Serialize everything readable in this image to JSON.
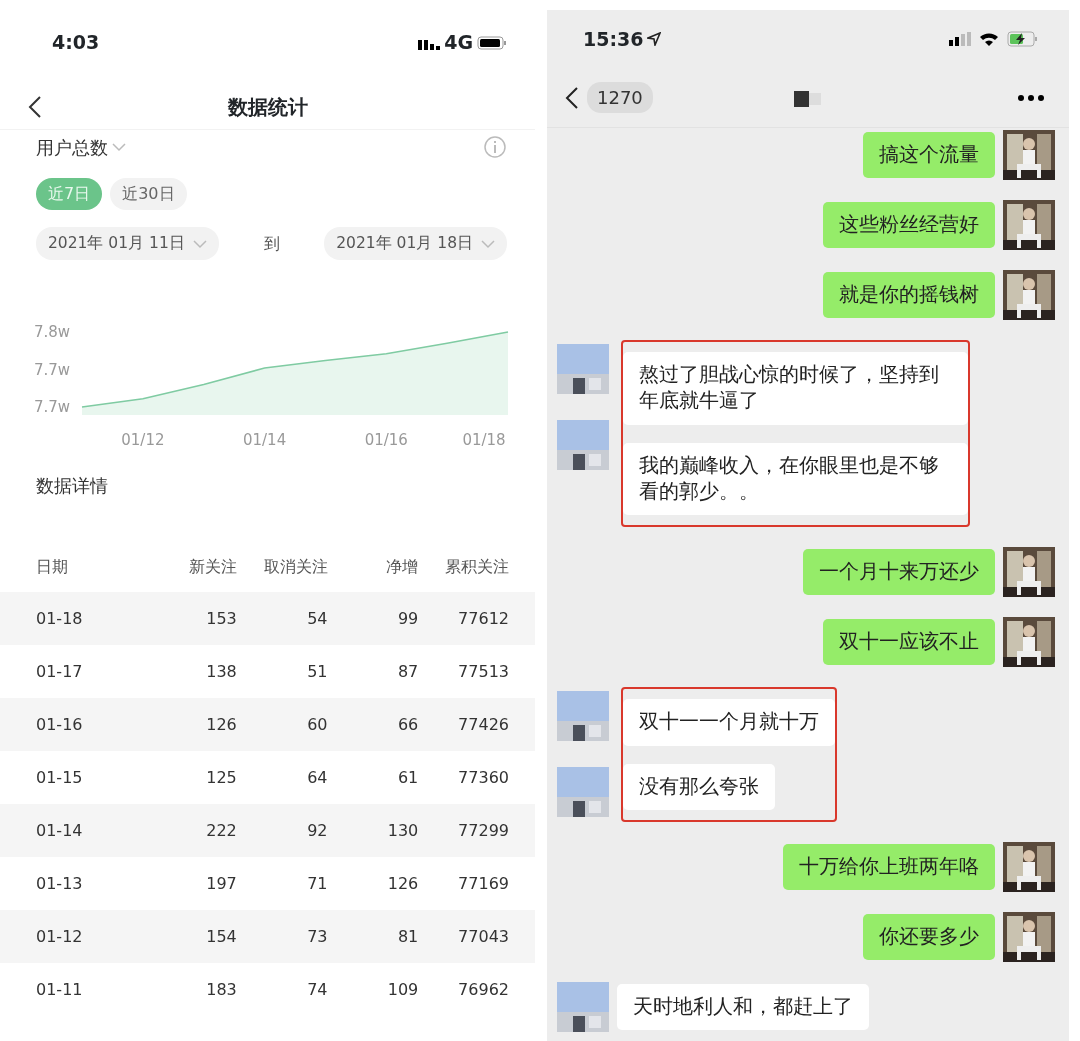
{
  "stats_screen": {
    "status_bar": {
      "time": "4:03",
      "network": "4G"
    },
    "title": "数据统计",
    "metric": "用户总数",
    "ranges": [
      {
        "label": "近7日",
        "selected": true
      },
      {
        "label": "近30日",
        "selected": false
      }
    ],
    "date_from": "2021年 01月 11日",
    "date_to_label": "到",
    "date_to": "2021年 01月 18日",
    "chart": {
      "y_labels": [
        "7.8w",
        "7.7w",
        "7.7w"
      ],
      "x_labels": [
        "01/12",
        "01/14",
        "01/16",
        "01/18"
      ]
    },
    "details_title": "数据详情",
    "table": {
      "columns": [
        "日期",
        "新关注",
        "取消关注",
        "净增",
        "累积关注"
      ],
      "rows": [
        [
          "01-18",
          "153",
          "54",
          "99",
          "77612"
        ],
        [
          "01-17",
          "138",
          "51",
          "87",
          "77513"
        ],
        [
          "01-16",
          "126",
          "60",
          "66",
          "77426"
        ],
        [
          "01-15",
          "125",
          "64",
          "61",
          "77360"
        ],
        [
          "01-14",
          "222",
          "92",
          "130",
          "77299"
        ],
        [
          "01-13",
          "197",
          "71",
          "126",
          "77169"
        ],
        [
          "01-12",
          "154",
          "73",
          "81",
          "77043"
        ],
        [
          "01-11",
          "183",
          "74",
          "109",
          "76962"
        ]
      ]
    }
  },
  "chat_screen": {
    "status_bar": {
      "time": "15:36"
    },
    "back_count": "1270",
    "items": [
      {
        "kind": "sent",
        "text": "搞这个流量"
      },
      {
        "kind": "sent",
        "text": "这些粉丝经营好"
      },
      {
        "kind": "sent",
        "text": "就是你的摇钱树"
      },
      {
        "kind": "highlight",
        "messages": [
          "熬过了胆战心惊的时候了，坚持到年底就牛逼了",
          "我的巅峰收入，在你眼里也是不够看的郭少。。"
        ]
      },
      {
        "kind": "sent",
        "text": "一个月十来万还少"
      },
      {
        "kind": "sent",
        "text": "双十一应该不止"
      },
      {
        "kind": "highlight",
        "messages": [
          "双十一一个月就十万",
          "没有那么夸张"
        ]
      },
      {
        "kind": "sent",
        "text": "十万给你上班两年咯"
      },
      {
        "kind": "sent",
        "text": "你还要多少"
      },
      {
        "kind": "received",
        "text": "天时地利人和，都赶上了"
      }
    ]
  }
}
